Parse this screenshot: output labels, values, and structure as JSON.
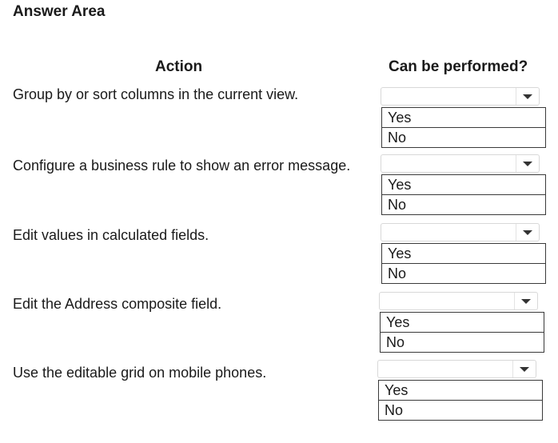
{
  "title": "Answer Area",
  "headers": {
    "action": "Action",
    "can_be_performed": "Can be performed?"
  },
  "rows": [
    {
      "action": "Group by or sort columns in the current view.",
      "options": [
        "Yes",
        "No"
      ]
    },
    {
      "action": "Configure a business rule to show an error message.",
      "options": [
        "Yes",
        "No"
      ]
    },
    {
      "action": "Edit values in calculated fields.",
      "options": [
        "Yes",
        "No"
      ]
    },
    {
      "action": "Edit the Address composite field.",
      "options": [
        "Yes",
        "No"
      ]
    },
    {
      "action": "Use the editable grid on mobile phones.",
      "options": [
        "Yes",
        "No"
      ]
    }
  ],
  "icons": {
    "dropdown": "chevron-down-icon"
  },
  "colors": {
    "text": "#1a1a1a",
    "border": "#3a3a3a",
    "dropdown_border": "#d8d8d8"
  }
}
